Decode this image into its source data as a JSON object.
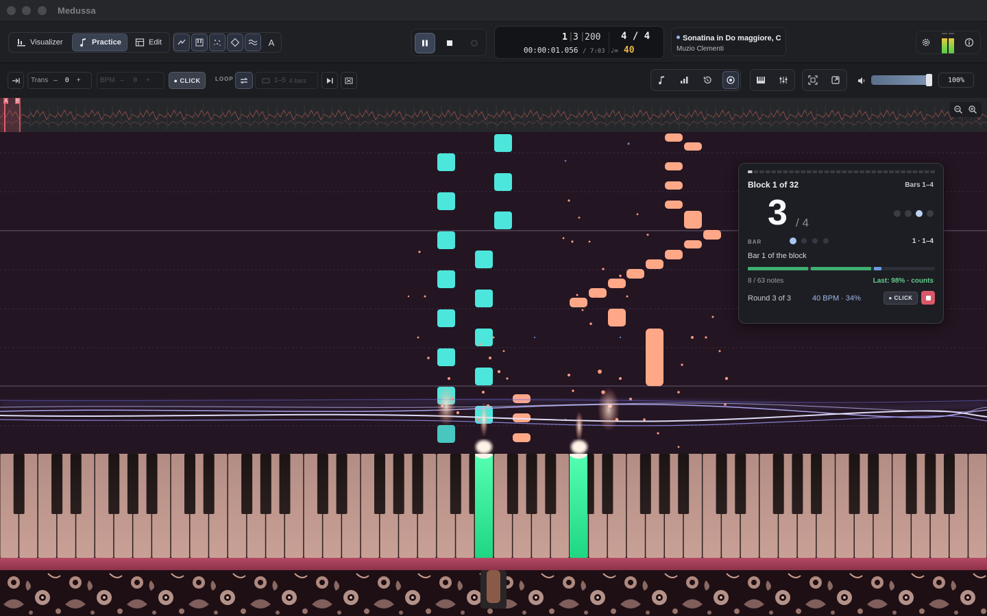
{
  "window": {
    "title": "Medussa"
  },
  "modes": [
    {
      "label": "Visualizer",
      "icon": "bars-icon"
    },
    {
      "label": "Practice",
      "icon": "music-note-icon",
      "active": true
    },
    {
      "label": "Edit",
      "icon": "table-icon"
    }
  ],
  "mode_tools": {
    "font_label": "A"
  },
  "counter": {
    "bar": "1",
    "beat": "3",
    "ticks": "200",
    "time": "00:00:01.056",
    "total": "7:03",
    "time_signature": "4 / 4",
    "tempo_symbol": "♩=",
    "tempo": "40"
  },
  "song": {
    "title": "Sonatina in Do maggiore, C",
    "composer": "Muzio Clementi"
  },
  "controls": {
    "trans_label": "Trans",
    "trans_value": "0",
    "minus": "–",
    "plus": "+",
    "bpm_label": "BPM",
    "bpm_value": "0",
    "click_label": "● CLICK",
    "loop_label": "LOOP",
    "loop_range": "1–5",
    "loop_bars": "4 bars",
    "zoom": "100%",
    "volume_level": 0.92
  },
  "overview": {
    "markers": [
      "A",
      "B"
    ]
  },
  "practice": {
    "block_title": "Block 1 of 32",
    "bars_range": "Bars 1–4",
    "current_bar": "3",
    "bars_total": "/ 4",
    "bar_label": "BAR",
    "bar_position": "1 · 1–4",
    "sub_label": "Bar 1 of the block",
    "notes_count": "8 / 63 notes",
    "last_result": "Last: 98% · counts",
    "round": "Round 3 of 3",
    "bpm_info": "40 BPM · 34%",
    "click_label": "● CLICK",
    "progress": 0.7,
    "block_progress_blocks": 32,
    "block_progress_done": 1
  },
  "colors": {
    "accent_blue": "#8fb5e8",
    "note_cyan": "#4de6dc",
    "note_salmon": "#ffa888",
    "key_pressed": "#2ee88f",
    "success": "#62cc8c",
    "tempo": "#e9b64a",
    "stop": "#d9586a"
  }
}
